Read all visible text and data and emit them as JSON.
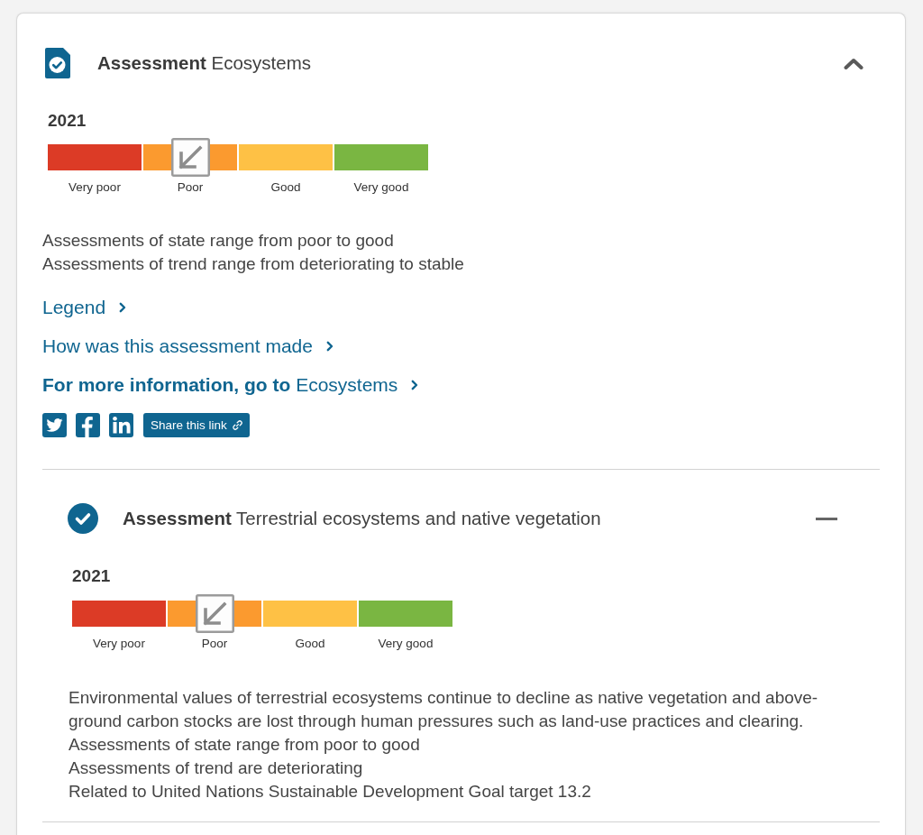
{
  "panel": {
    "sections": [
      {
        "kind": "group",
        "title": "**Assessment** Ecosystems",
        "expanded": true,
        "year": "2021",
        "scale": [
          {
            "label": "Very poor",
            "color": "#dc3b26",
            "selected": false
          },
          {
            "label": "Poor",
            "color": "#fb9a2f",
            "selected": true
          },
          {
            "label": "Good",
            "color": "#fec145",
            "selected": false
          },
          {
            "label": "Very good",
            "color": "#7ab642",
            "selected": false
          }
        ],
        "trend": {
          "kind": "deteriorating"
        },
        "description": [
          "Assessments of state range from poor to good",
          "Assessments of trend range from deteriorating to stable"
        ],
        "links": [
          "Legend",
          "How was this assessment made",
          "**For more information, go to** Ecosystems"
        ],
        "share_button": "Share this link",
        "children": [
          {
            "kind": "item",
            "title": "**Assessment** Terrestrial ecosystems and native vegetation",
            "expanded": true,
            "year": "2021",
            "scale": [
              {
                "label": "Very poor",
                "color": "#dc3b26",
                "selected": false
              },
              {
                "label": "Poor",
                "color": "#fb9a2f",
                "selected": true
              },
              {
                "label": "Good",
                "color": "#fec145",
                "selected": false
              },
              {
                "label": "Very good",
                "color": "#7ab642",
                "selected": false
              }
            ],
            "trend": {
              "kind": "deteriorating"
            },
            "description": [
              "Environmental values of terrestrial ecosystems continue to decline as native vegetation and above-ground carbon stocks are lost through human pressures such as land-use practices and clearing.",
              "Assessments of state range from poor to good",
              "Assessments of trend are deteriorating",
              "Related to United Nations Sustainable Development Goal target 13.2"
            ]
          }
        ]
      }
    ]
  }
}
